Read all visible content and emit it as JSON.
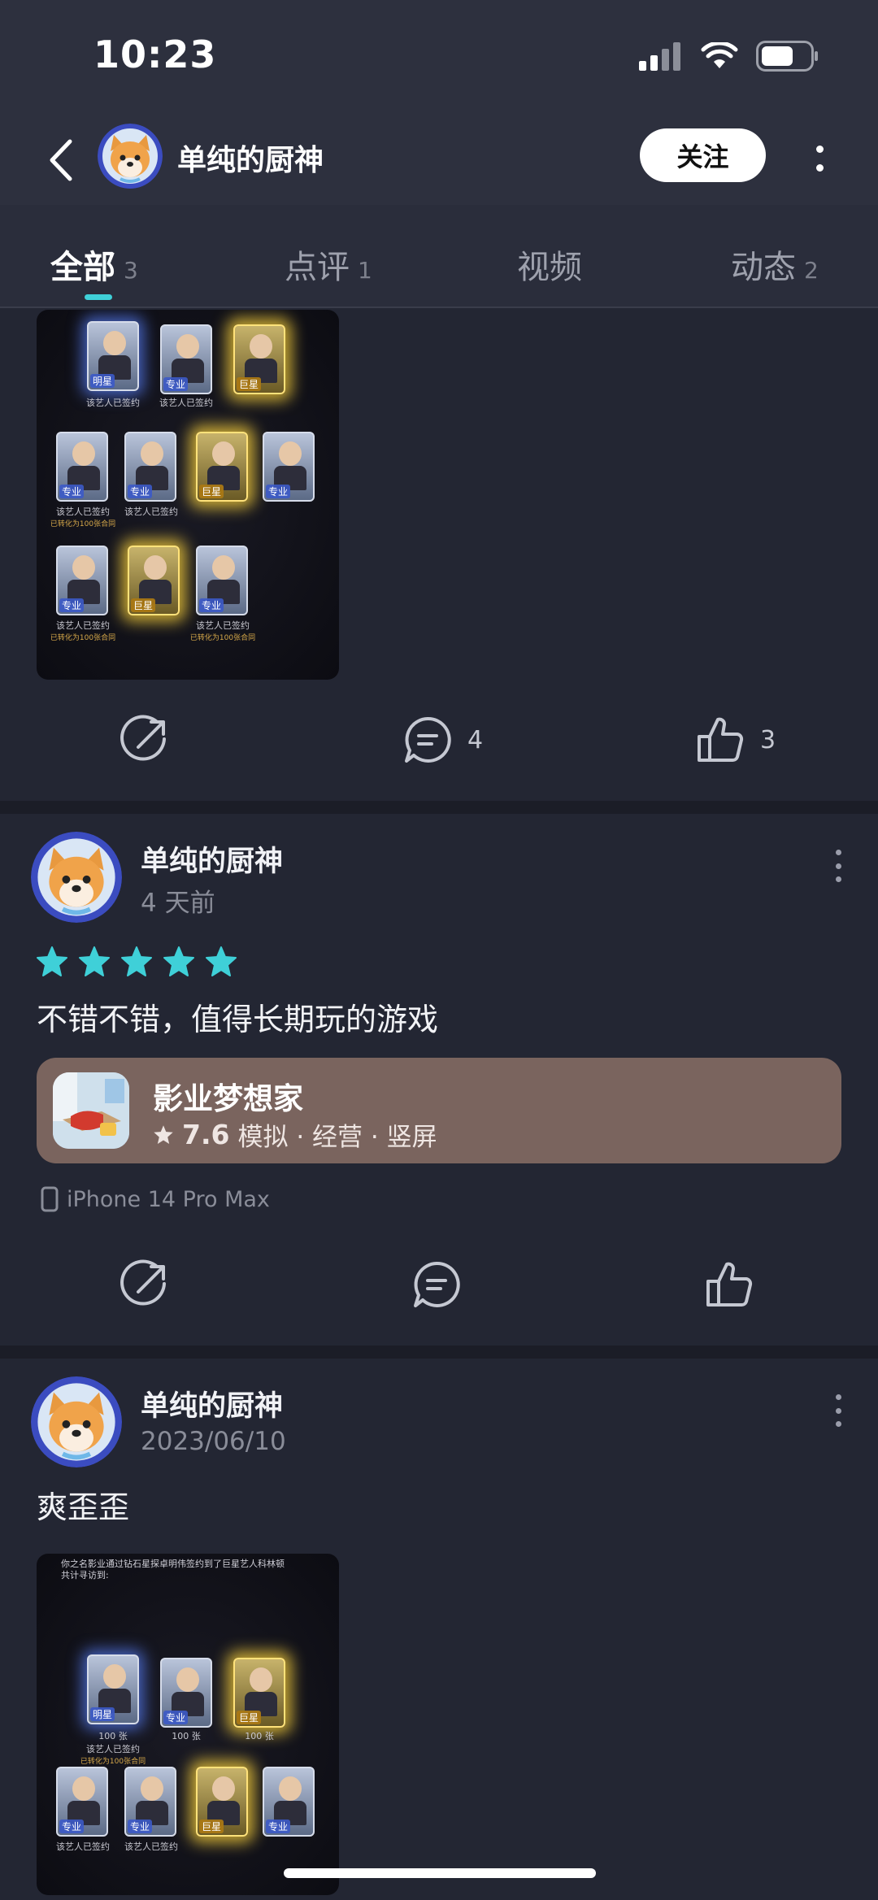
{
  "status_bar": {
    "time": "10:23"
  },
  "header": {
    "username": "单纯的厨神",
    "follow_label": "关注"
  },
  "tabs": [
    {
      "label": "全部",
      "count": "3"
    },
    {
      "label": "点评",
      "count": "1"
    },
    {
      "label": "视频",
      "count": ""
    },
    {
      "label": "动态",
      "count": "2"
    }
  ],
  "feed_top": {
    "actions": {
      "comments": "4",
      "likes": "3"
    }
  },
  "review_post": {
    "author": "单纯的厨神",
    "time": "4 天前",
    "rating_stars": 5,
    "text": "不错不错，值得长期玩的游戏",
    "game": {
      "name": "影业梦想家",
      "rating": "7.6",
      "tags": "模拟 · 经营 · 竖屏"
    },
    "device": "iPhone 14 Pro Max"
  },
  "moment_post": {
    "author": "单纯的厨神",
    "time": "2023/06/10",
    "text": "爽歪歪"
  },
  "screenshot": {
    "card_tags": [
      "明星",
      "专业",
      "巨星",
      "专业",
      "专业",
      "巨星",
      "专业",
      "专业",
      "巨星",
      "专业"
    ],
    "card_count": "100 张",
    "card_note": "该艺人已签约",
    "card_note2": "已转化为100张合同",
    "top_line": "你之名影业通过钻石星探卓明伟签约到了巨星艺人科林顿",
    "top_line2": "共计寻访到:"
  },
  "colors": {
    "accent": "#3fd0d8",
    "background": "#232633",
    "game_card": "#7a645e"
  }
}
